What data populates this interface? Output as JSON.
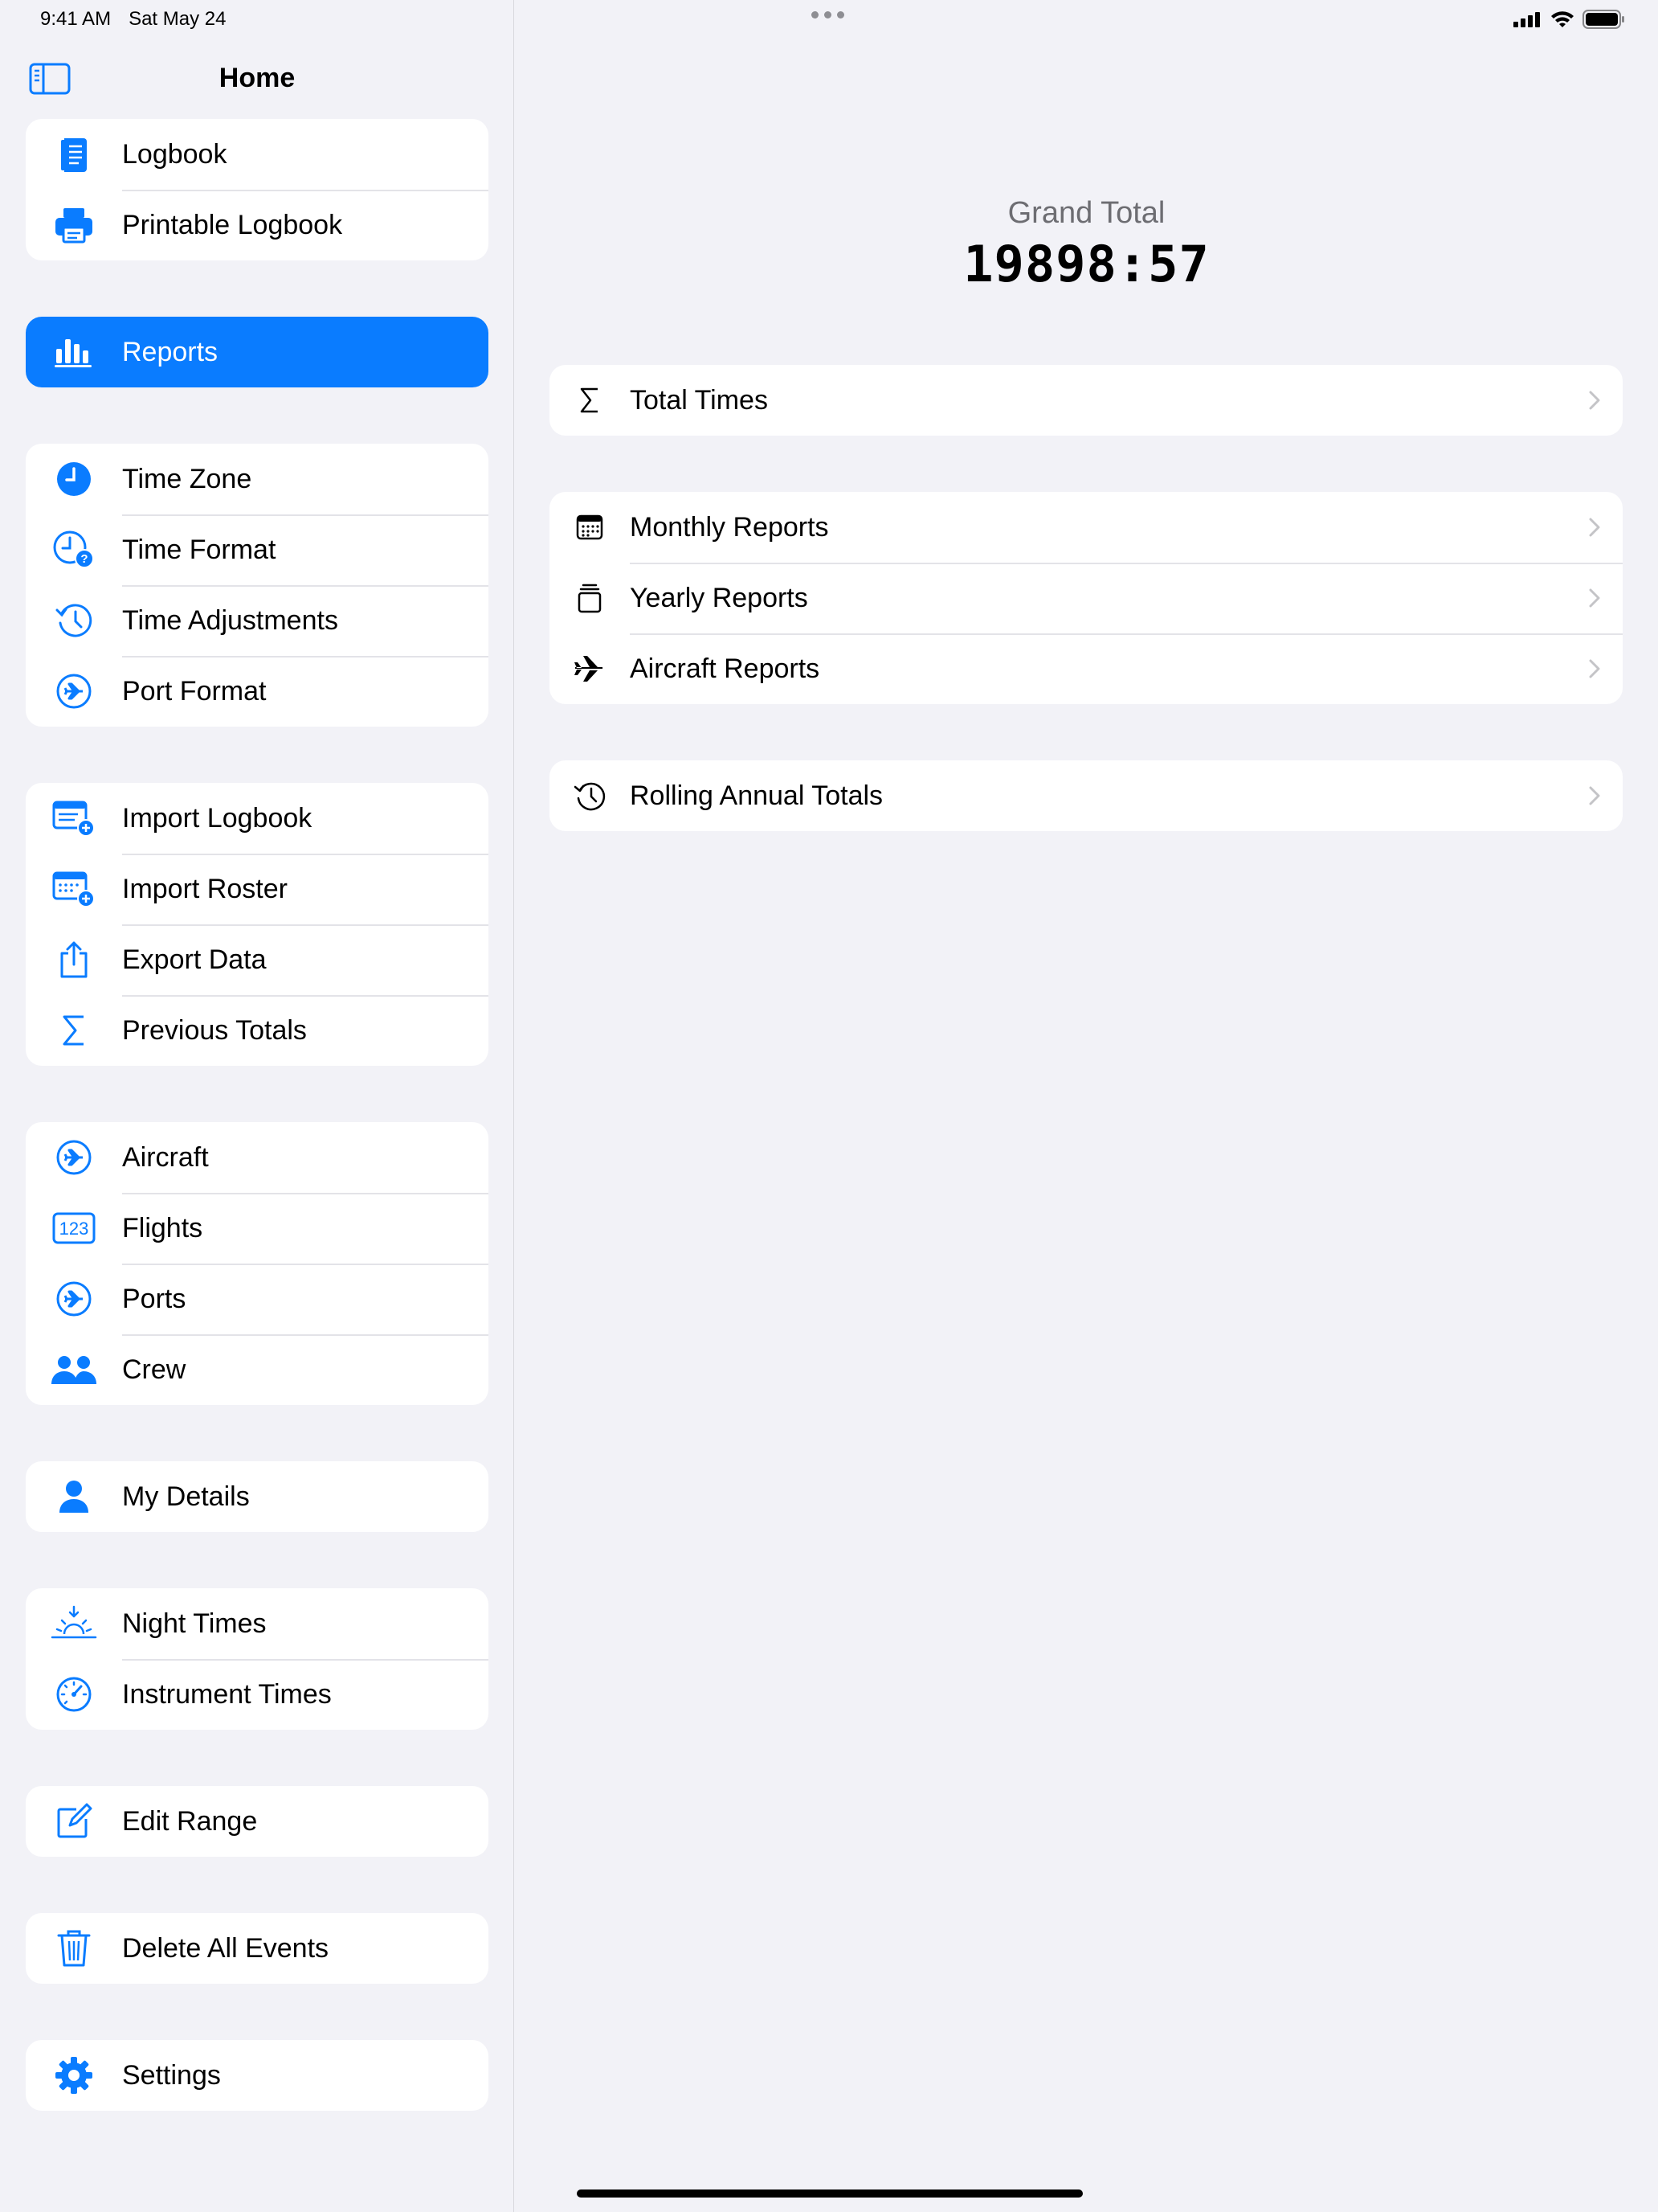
{
  "status": {
    "time": "9:41 AM",
    "date": "Sat May 24"
  },
  "sidebar": {
    "title": "Home",
    "groups": [
      [
        {
          "label": "Logbook",
          "icon": "book-icon"
        },
        {
          "label": "Printable Logbook",
          "icon": "printer-icon"
        }
      ],
      [
        {
          "label": "Reports",
          "icon": "chart-bar-icon",
          "selected": true
        }
      ],
      [
        {
          "label": "Time Zone",
          "icon": "clock-fill-icon"
        },
        {
          "label": "Time Format",
          "icon": "clock-question-icon"
        },
        {
          "label": "Time Adjustments",
          "icon": "clock-arrow-icon"
        },
        {
          "label": "Port Format",
          "icon": "airplane-circle-icon"
        }
      ],
      [
        {
          "label": "Import Logbook",
          "icon": "list-plus-icon"
        },
        {
          "label": "Import Roster",
          "icon": "calendar-plus-icon"
        },
        {
          "label": "Export Data",
          "icon": "share-icon"
        },
        {
          "label": "Previous Totals",
          "icon": "sigma-icon"
        }
      ],
      [
        {
          "label": "Aircraft",
          "icon": "airplane-circle-icon"
        },
        {
          "label": "Flights",
          "icon": "number-123-icon"
        },
        {
          "label": "Ports",
          "icon": "airplane-circle-icon"
        },
        {
          "label": "Crew",
          "icon": "people-icon"
        }
      ],
      [
        {
          "label": "My Details",
          "icon": "person-icon"
        }
      ],
      [
        {
          "label": "Night Times",
          "icon": "sunset-icon"
        },
        {
          "label": "Instrument Times",
          "icon": "gauge-icon"
        }
      ],
      [
        {
          "label": "Edit Range",
          "icon": "edit-icon"
        }
      ],
      [
        {
          "label": "Delete All Events",
          "icon": "trash-icon"
        }
      ],
      [
        {
          "label": "Settings",
          "icon": "gear-icon"
        }
      ]
    ]
  },
  "detail": {
    "grand_total_label": "Grand Total",
    "grand_total_value": "19898:57",
    "groups": [
      [
        {
          "label": "Total Times",
          "icon": "sigma-icon"
        }
      ],
      [
        {
          "label": "Monthly Reports",
          "icon": "calendar-icon"
        },
        {
          "label": "Yearly Reports",
          "icon": "stack-icon"
        },
        {
          "label": "Aircraft Reports",
          "icon": "airplane-icon"
        }
      ],
      [
        {
          "label": "Rolling Annual Totals",
          "icon": "history-icon"
        }
      ]
    ]
  },
  "colors": {
    "accent": "#0a7cff",
    "background": "#f2f2f7",
    "separator": "#e3e3e8",
    "chevron": "#c4c4c7"
  }
}
